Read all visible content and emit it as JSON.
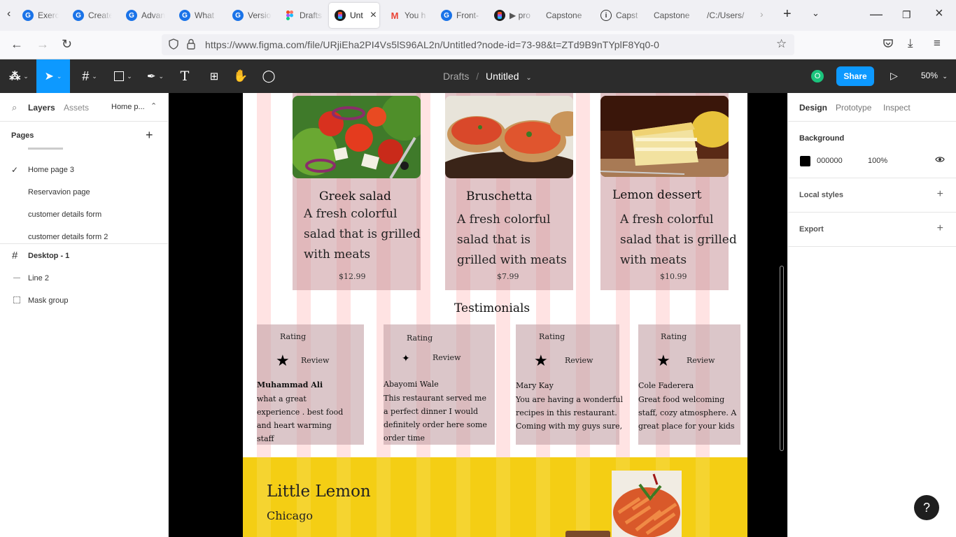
{
  "browser": {
    "tabs": [
      {
        "label": "Exerci",
        "icon": "g"
      },
      {
        "label": "Create",
        "icon": "g"
      },
      {
        "label": "Advan",
        "icon": "g"
      },
      {
        "label": "What",
        "icon": "g"
      },
      {
        "label": "Versio",
        "icon": "g"
      },
      {
        "label": "Drafts",
        "icon": "fig"
      },
      {
        "label": "Unt",
        "icon": "figdark",
        "active": true
      },
      {
        "label": "You h",
        "icon": "gmail"
      },
      {
        "label": "Front-",
        "icon": "g"
      },
      {
        "label": "▶ pro",
        "icon": "figdark"
      },
      {
        "label": "Capstone",
        "icon": ""
      },
      {
        "label": "Capst",
        "icon": "info"
      },
      {
        "label": "Capstone",
        "icon": ""
      },
      {
        "label": "/C:/Users/",
        "icon": ""
      }
    ],
    "url": "https://www.figma.com/file/URjiEha2PI4Vs5lS96AL2n/Untitled?node-id=73-98&t=ZTd9B9nTYplF8Yq0-0"
  },
  "toolbar": {
    "breadcrumb_parent": "Drafts",
    "breadcrumb_sep": "/",
    "file_name": "Untitled",
    "avatar_initial": "O",
    "share_label": "Share",
    "zoom": "50%"
  },
  "left_panel": {
    "tabs": {
      "layers": "Layers",
      "assets": "Assets",
      "page_selector": "Home p..."
    },
    "pages_heading": "Pages",
    "pages": [
      {
        "name": "Home page 3",
        "current": true
      },
      {
        "name": "Reservavion page"
      },
      {
        "name": "customer details form"
      },
      {
        "name": "customer details form 2"
      }
    ],
    "layers": [
      {
        "name": "Desktop - 1",
        "icon": "frame"
      },
      {
        "name": "Line 2",
        "icon": "line"
      },
      {
        "name": "Mask group",
        "icon": "mask"
      }
    ]
  },
  "design": {
    "menu": [
      {
        "name": "Greek salad",
        "desc": [
          "A fresh colorful",
          "salad that is grilled",
          "with meats"
        ],
        "price": "$12.99"
      },
      {
        "name": "Bruschetta",
        "desc": [
          "A fresh colorful",
          "salad that is",
          "grilled with meats"
        ],
        "price": "$7.99"
      },
      {
        "name": "Lemon dessert",
        "desc": [
          "A fresh colorful",
          "salad that is grilled",
          "with meats"
        ],
        "price": "$10.99"
      }
    ],
    "testimonials_heading": "Testimonials",
    "rating_label": "Rating",
    "review_label": "Review",
    "testimonials": [
      {
        "name": "Muhammad  Ali",
        "text": [
          "what a great",
          "experience . best food",
          "and  heart warming",
          "staff"
        ]
      },
      {
        "name": "Abayomi  Wale",
        "text": [
          "This restaurant served me",
          "a perfect dinner I would",
          "definitely order here some",
          "order time"
        ]
      },
      {
        "name": "Mary Kay",
        "text": [
          "You are having a wonderful",
          "recipes in this restaurant.",
          "Coming with my guys sure,"
        ]
      },
      {
        "name": "Cole Faderera",
        "text": [
          "Great food welcoming",
          "staff, cozy atmosphere. A",
          "great place for your kids"
        ]
      }
    ],
    "footer": {
      "brand": "Little Lemon",
      "city": "Chicago"
    }
  },
  "right_panel": {
    "tabs": {
      "design": "Design",
      "prototype": "Prototype",
      "inspect": "Inspect"
    },
    "background_heading": "Background",
    "background_color": "000000",
    "background_opacity": "100%",
    "local_styles": "Local styles",
    "export": "Export"
  },
  "help": "?"
}
